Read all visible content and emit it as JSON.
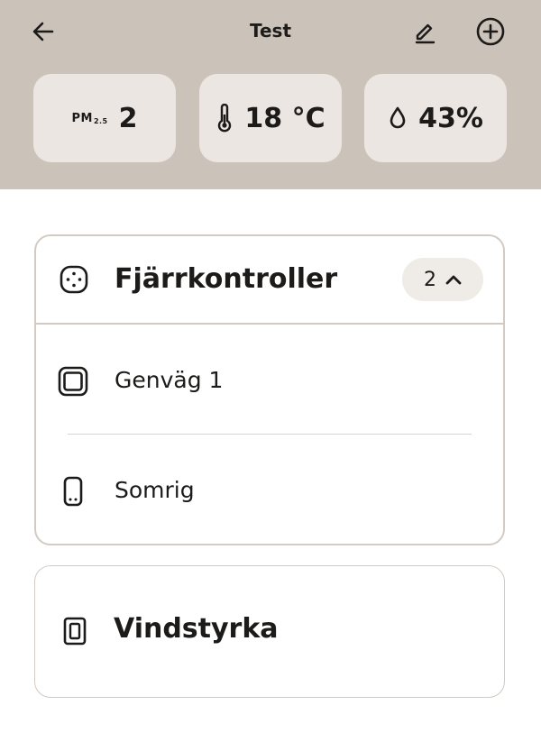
{
  "header": {
    "title": "Test",
    "stats": [
      {
        "label": "PM",
        "label_sub": "2.5",
        "value": "2"
      },
      {
        "value": "18 °C",
        "icon": "thermometer-icon"
      },
      {
        "value": "43%",
        "icon": "droplet-icon"
      }
    ]
  },
  "cards": {
    "remotes": {
      "title": "Fjärrkontroller",
      "count": "2",
      "items": [
        {
          "label": "Genväg 1",
          "icon": "shortcut-square-icon"
        },
        {
          "label": "Somrig",
          "icon": "remote-device-icon"
        }
      ]
    },
    "wind": {
      "title": "Vindstyrka",
      "icon": "panel-icon"
    }
  }
}
